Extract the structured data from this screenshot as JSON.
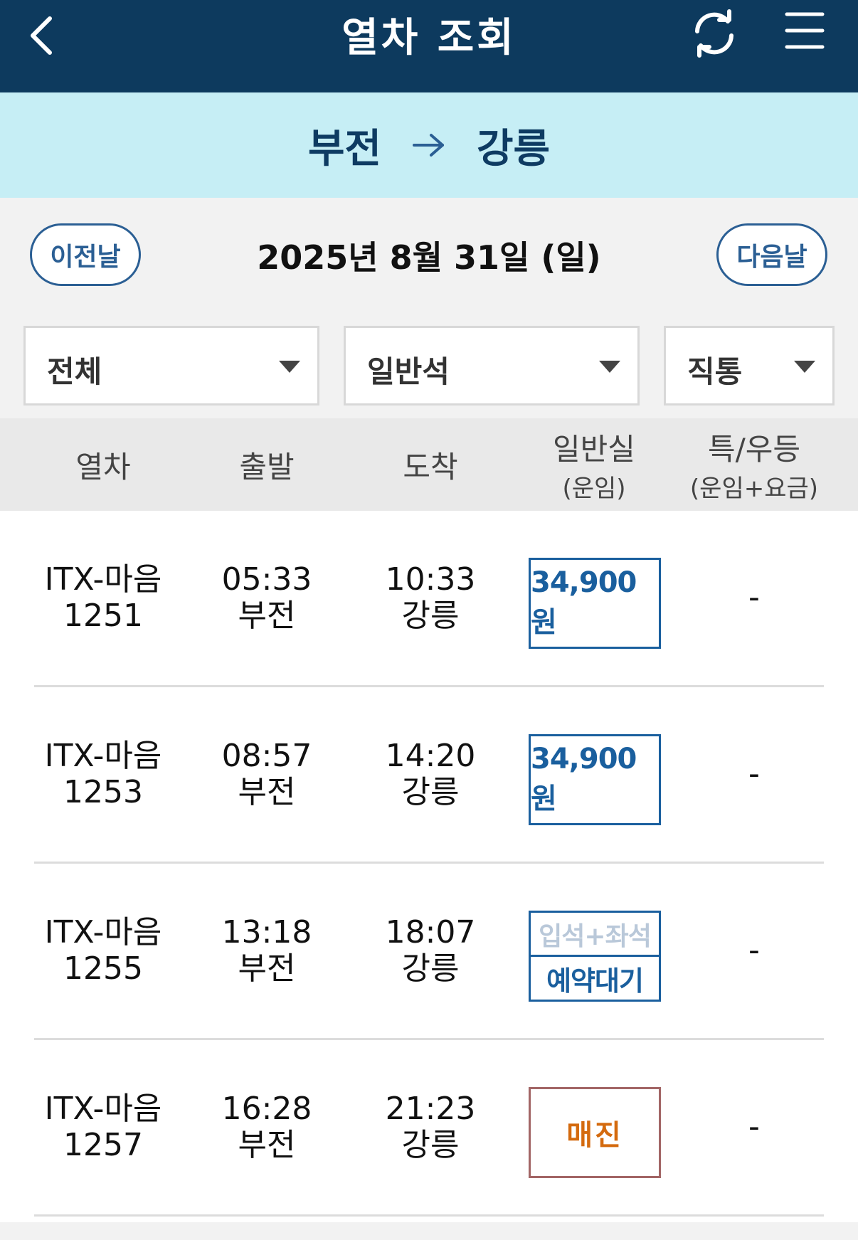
{
  "header": {
    "title": "열차 조회",
    "back_icon": "chevron-left-icon",
    "refresh_icon": "refresh-icon",
    "menu_icon": "hamburger-menu-icon"
  },
  "route": {
    "from": "부전",
    "to": "강릉"
  },
  "date_bar": {
    "prev_label": "이전날",
    "date": "2025년 8월 31일 (일)",
    "next_label": "다음날"
  },
  "filters": {
    "train_type": "전체",
    "seat_class": "일반석",
    "route_type": "직통"
  },
  "table": {
    "headers": {
      "train": "열차",
      "departure": "출발",
      "arrival": "도착",
      "general_main": "일반실",
      "general_sub": "(운임)",
      "special_main": "특/우등",
      "special_sub": "(운임+요금)"
    },
    "rows": [
      {
        "train_name": "ITX-마음",
        "train_no": "1251",
        "dep_time": "05:33",
        "dep_station": "부전",
        "arr_time": "10:33",
        "arr_station": "강릉",
        "fare": "34,900원",
        "special": "-"
      },
      {
        "train_name": "ITX-마음",
        "train_no": "1253",
        "dep_time": "08:57",
        "dep_station": "부전",
        "arr_time": "14:20",
        "arr_station": "강릉",
        "fare": "34,900원",
        "special": "-"
      },
      {
        "train_name": "ITX-마음",
        "train_no": "1255",
        "dep_time": "13:18",
        "dep_station": "부전",
        "arr_time": "18:07",
        "arr_station": "강릉",
        "fare_top": "입석+좌석",
        "fare_bottom": "예약대기",
        "special": "-"
      },
      {
        "train_name": "ITX-마음",
        "train_no": "1257",
        "dep_time": "16:28",
        "dep_station": "부전",
        "arr_time": "21:23",
        "arr_station": "강릉",
        "fare": "매진",
        "special": "-"
      }
    ]
  },
  "colors": {
    "header_bg": "#0d3a5e",
    "route_bg": "#c6eef5",
    "accent_blue": "#1a5f9e",
    "sold_out": "#d46a0e"
  }
}
